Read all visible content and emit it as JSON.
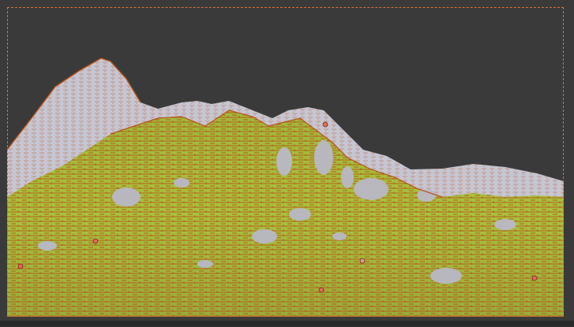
{
  "viewport": {
    "background_color": "#3a3a3a",
    "selection_color": "#e07030"
  },
  "terrain": {
    "snow_color": "#c9c9d6",
    "grass_color": "#a8c23c",
    "edge_color": "#b8541c",
    "vertex_color": "#e06a5a",
    "vertex_count_visible": 6
  }
}
